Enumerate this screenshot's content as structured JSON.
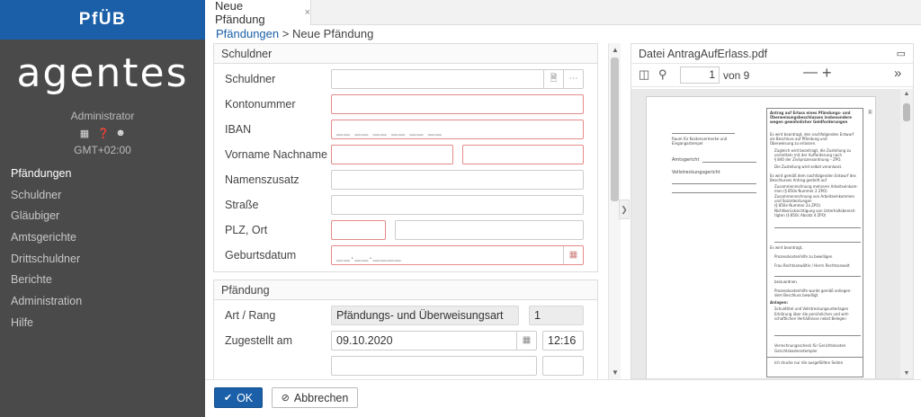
{
  "app": {
    "brand": "PfÜB",
    "logo": "agentes",
    "user": "Administrator",
    "timezone": "GMT+02:00"
  },
  "nav": {
    "items": [
      {
        "label": "Pfändungen"
      },
      {
        "label": "Schuldner"
      },
      {
        "label": "Gläubiger"
      },
      {
        "label": "Amtsgerichte"
      },
      {
        "label": "Drittschuldner"
      },
      {
        "label": "Berichte"
      },
      {
        "label": "Administration"
      },
      {
        "label": "Hilfe"
      }
    ],
    "active": "Pfändungen"
  },
  "tab": {
    "label": "Neue Pfändung",
    "close": "×"
  },
  "breadcrumb": {
    "link": "Pfändungen",
    "separator": ">",
    "current": "Neue Pfändung"
  },
  "schuldner_section": {
    "title": "Schuldner",
    "fields": {
      "schuldner": "Schuldner",
      "kontonummer": "Kontonummer",
      "iban": "IBAN",
      "iban_mask": "__ __ __ __ __ __",
      "name": "Vorname Nachname",
      "namenszusatz": "Namenszusatz",
      "strasse": "Straße",
      "plz_ort": "PLZ, Ort",
      "geburtsdatum": "Geburtsdatum",
      "geburtsdatum_mask": "__.__.____"
    }
  },
  "pfaendung_section": {
    "title": "Pfändung",
    "art_rang_label": "Art / Rang",
    "art_value": "Pfändungs- und Überweisungsart",
    "rang_value": "1",
    "zugestellt_label": "Zugestellt am",
    "zugestellt_date": "09.10.2020",
    "zugestellt_time": "12:16"
  },
  "pdf": {
    "title": "Datei AntragAufErlass.pdf",
    "page": "1",
    "page_of": "von 9",
    "doc_heading": "Antrag auf Erlass eines Pfändungs- und Überweisungsbeschlusses insbesondere wegen gewöhnlicher Geldforderungen",
    "amtsgericht": "Amtsgericht",
    "vollstreckungsgericht": "Vollstreckungsgericht",
    "page_number": "1",
    "stamp": "Raum für Kostenvermerke und Eingangsstempel",
    "lines": [
      "Es wird beantragt, den nachfolgenden Entwurf",
      "als Beschluss auf Pfändung und",
      "Überweisung zu erlassen.",
      "Zugleich wird beantragt, die Zustellung zu",
      "vermitteln mit der Aufforderung nach",
      "§ 840 der Zivilprozessordnung – ZPO.",
      "Die Zustellung wird selbst veranlasst.",
      "Es wird gemäß dem nachfolgenden Entwurf des",
      "Beschlusses Antrag gestellt auf",
      "Zusammenrechnung mehrerer Arbeitseinkom-",
      "men (§ 850e Nummer 2 ZPO)",
      "Zusammenrechnung von Arbeitseinkommen",
      "und Sozialleistungen",
      "(§ 850e Nummer 2a ZPO)",
      "Nichtberücksichtigung von Unterhaltsberech-",
      "tigten (§ 850c Absatz 4 ZPO)",
      "Es wird beantragt,",
      "Prozesskostenhilfe zu bewilligen",
      "Frau Rechtsanwältin / Herrn Rechtsanwalt",
      "beizuordnen.",
      "Prozesskostenhilfe wurde gemäß anliegen-",
      "dem Beschluss bewilligt.",
      "Anlagen:",
      "Schuldtitel und Vollstreckungsunterlagen",
      "Erklärung über die persönlichen und wirt-",
      "schaftlichen Verhältnisse nebst Belegen",
      "Verrechnungsscheck für Gerichtskosten",
      "Gerichtskostenstempler",
      "Ich drucke nur die ausgefüllten Seiten"
    ]
  },
  "footer": {
    "ok_label": "OK",
    "cancel_label": "Abbrechen"
  },
  "colors": {
    "brand_blue": "#1a5fa8",
    "sidebar": "#4a4a4a",
    "error_border": "#e58a8a"
  }
}
